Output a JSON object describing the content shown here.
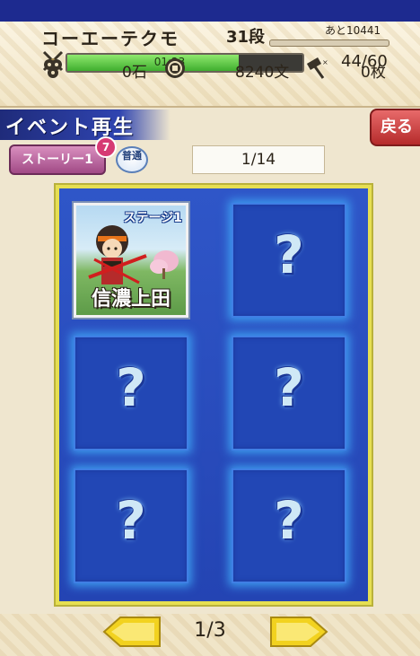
{
  "header": {
    "player_name": "コーエーテクモ",
    "rank": "31段",
    "exp_next": "あと10441",
    "stamina_time": "01:23",
    "stamina_value": "44/60",
    "stamina_fill_fraction": 0.73,
    "koku": "0石",
    "mon": "8240文",
    "tickets": "0枚"
  },
  "toolbar": {
    "title": "イベント再生",
    "back_label": "戻る",
    "story_label": "ストーリー1",
    "story_badge": "7",
    "difficulty_label": "普通",
    "counter": "1/14"
  },
  "slots": [
    {
      "state": "open",
      "stage_label": "ステージ1",
      "location": "信濃上田"
    },
    {
      "state": "locked",
      "symbol": "?"
    },
    {
      "state": "locked",
      "symbol": "?"
    },
    {
      "state": "locked",
      "symbol": "?"
    },
    {
      "state": "locked",
      "symbol": "?"
    },
    {
      "state": "locked",
      "symbol": "?"
    }
  ],
  "footer": {
    "page": "1/3"
  },
  "colors": {
    "panel_blue": "#2444b3",
    "panel_border": "#e6df52",
    "back_red": "#b52b2b",
    "story_pink": "#a14a86",
    "arrow_yellow": "#f2d21f"
  }
}
